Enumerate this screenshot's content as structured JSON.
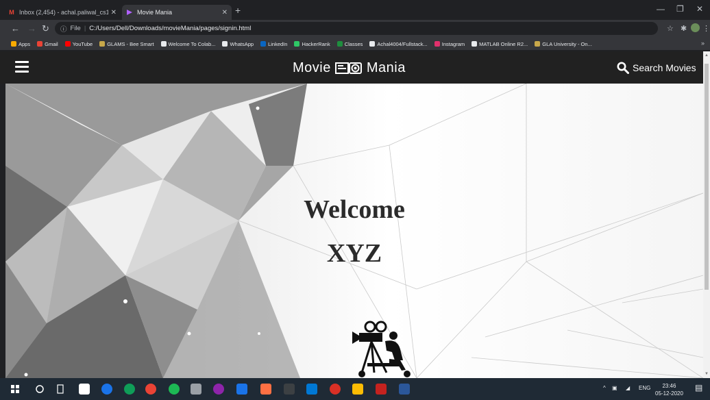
{
  "browser": {
    "tabs": [
      {
        "title": "Inbox (2,454) - achal.paliwal_cs1",
        "active": false,
        "favicon": "gmail-icon"
      },
      {
        "title": "Movie Mania",
        "active": true,
        "favicon": "movie-mania-icon"
      }
    ],
    "url_scheme_label": "File",
    "url": "C:/Users/Dell/Downloads/movieMania/pages/signin.html",
    "bookmarks": [
      {
        "label": "Apps",
        "color": "#f9ab00"
      },
      {
        "label": "Gmail",
        "color": "#ea4335"
      },
      {
        "label": "YouTube",
        "color": "#ff0000"
      },
      {
        "label": "GLAMS - Bee Smart",
        "color": "#c8a84a"
      },
      {
        "label": "Welcome To Colab...",
        "color": "#e8eaed"
      },
      {
        "label": "WhatsApp",
        "color": "#e8eaed"
      },
      {
        "label": "LinkedIn",
        "color": "#0a66c2"
      },
      {
        "label": "HackerRank",
        "color": "#2ec866"
      },
      {
        "label": "Classes",
        "color": "#1e8e3e"
      },
      {
        "label": "Achal4004/Fullstack...",
        "color": "#e8eaed"
      },
      {
        "label": "Instagram",
        "color": "#e1306c"
      },
      {
        "label": "MATLAB Online R2...",
        "color": "#e8eaed"
      },
      {
        "label": "GLA University - On...",
        "color": "#c8a84a"
      }
    ],
    "bookmarks_overflow": "»"
  },
  "site": {
    "brand_left": "Movie",
    "brand_right": "Mania",
    "search_label": "Search Movies",
    "welcome_line1": "Welcome",
    "welcome_line2": "XYZ"
  },
  "taskbar": {
    "language": "ENG",
    "time": "23:46",
    "date": "05-12-2020"
  }
}
